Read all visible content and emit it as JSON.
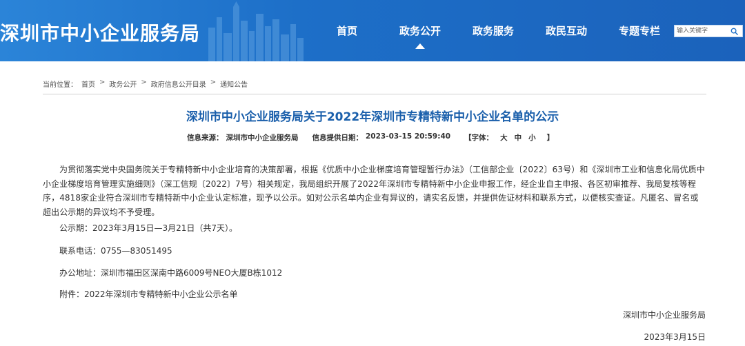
{
  "header": {
    "site_title": "深圳市中小企业服务局",
    "nav": [
      {
        "label": "首页"
      },
      {
        "label": "政务公开"
      },
      {
        "label": "政务服务"
      },
      {
        "label": "政民互动"
      },
      {
        "label": "专题专栏"
      }
    ],
    "active_nav": "政务公开",
    "search_placeholder": "输入关键字"
  },
  "breadcrumb": {
    "prefix": "当前位置：",
    "items": [
      "首页",
      "政务公开",
      "政府信息公开目录",
      "通知公告"
    ],
    "separator": ">"
  },
  "article": {
    "title": "深圳市中小企业服务局关于2022年深圳市专精特新中小企业名单的公示",
    "meta": {
      "source_label": "信息来源：",
      "source": "深圳市中小企业服务局",
      "date_label": "信息提供日期：",
      "date": "2023-03-15 20:59:40",
      "font_label": "【字体：",
      "font_large": "大",
      "font_medium": "中",
      "font_small": "小",
      "font_close": "】"
    },
    "body": "为贯彻落实党中央国务院关于专精特新中小企业培育的决策部署，根据《优质中小企业梯度培育管理暂行办法》（工信部企业〔2022〕63号）和《深圳市工业和信息化局优质中小企业梯度培育管理实施细则》（深工信规〔2022〕7号）相关规定，我局组织开展了2022年深圳市专精特新中小企业申报工作，经企业自主申报、各区初审推荐、我局复核等程序，4818家企业符合深圳市专精特新中小企业认定标准，现予以公示。如对公示名单内企业有异议的，请实名反馈，并提供佐证材料和联系方式，以便核实查证。凡匿名、冒名或超出公示期的异议均不予受理。",
    "period": "公示期：2023年3月15日—3月21日（共7天）。",
    "phone": "联系电话：0755—83051495",
    "address": "办公地址：深圳市福田区深南中路6009号NEO大厦B栋1012",
    "attachment": "附件：2022年深圳市专精特新中小企业公示名单",
    "signature": "深圳市中小企业服务局",
    "sign_date": "2023年3月15日"
  },
  "colors": {
    "header_bg": "#1d6fc8",
    "title_blue": "#1a5fab"
  },
  "icons": {
    "search": "search-icon",
    "active_nav_indicator": "triangle-up-icon"
  }
}
